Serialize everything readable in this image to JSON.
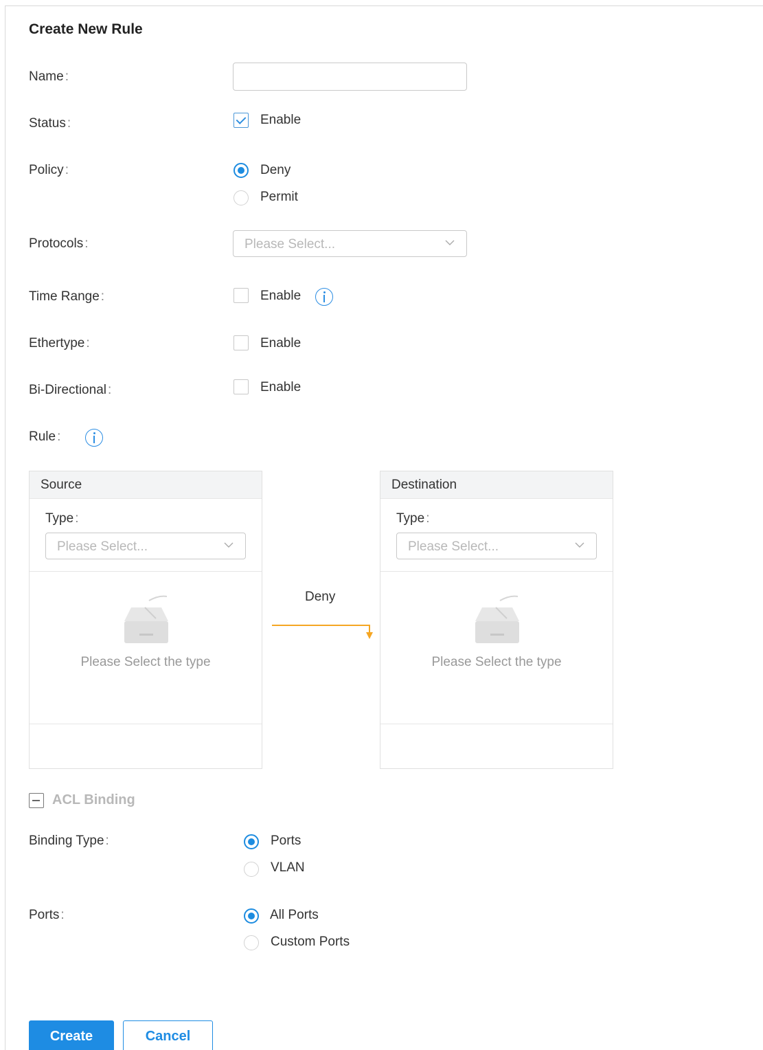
{
  "dialog": {
    "title": "Create New Rule"
  },
  "form": {
    "name": {
      "label": "Name",
      "value": "",
      "placeholder": ""
    },
    "status": {
      "label": "Status",
      "option": "Enable",
      "checked": true
    },
    "policy": {
      "label": "Policy",
      "options": [
        "Deny",
        "Permit"
      ],
      "selected": "Deny"
    },
    "protocols": {
      "label": "Protocols",
      "placeholder": "Please Select..."
    },
    "time_range": {
      "label": "Time Range",
      "option": "Enable",
      "checked": false
    },
    "ethertype": {
      "label": "Ethertype",
      "option": "Enable",
      "checked": false
    },
    "bi_directional": {
      "label": "Bi-Directional",
      "option": "Enable",
      "checked": false
    },
    "rule": {
      "label": "Rule"
    }
  },
  "rule_panels": {
    "source": {
      "title": "Source",
      "type_label": "Type",
      "placeholder": "Please Select...",
      "empty_text": "Please Select the type"
    },
    "destination": {
      "title": "Destination",
      "type_label": "Type",
      "placeholder": "Please Select...",
      "empty_text": "Please Select the type"
    },
    "action_label": "Deny"
  },
  "acl_binding": {
    "section_title": "ACL Binding",
    "binding_type": {
      "label": "Binding Type",
      "options": [
        "Ports",
        "VLAN"
      ],
      "selected": "Ports"
    },
    "ports": {
      "label": "Ports",
      "options": [
        "All Ports",
        "Custom Ports"
      ],
      "selected": "All Ports"
    }
  },
  "actions": {
    "create_label": "Create",
    "cancel_label": "Cancel"
  },
  "colors": {
    "accent": "#1e8ce3",
    "arrow": "#f5a623"
  },
  "icons": {
    "info": "info-circle-icon",
    "chevron": "chevron-down-icon",
    "empty": "empty-inbox-icon",
    "collapse": "collapse-minus-icon"
  }
}
